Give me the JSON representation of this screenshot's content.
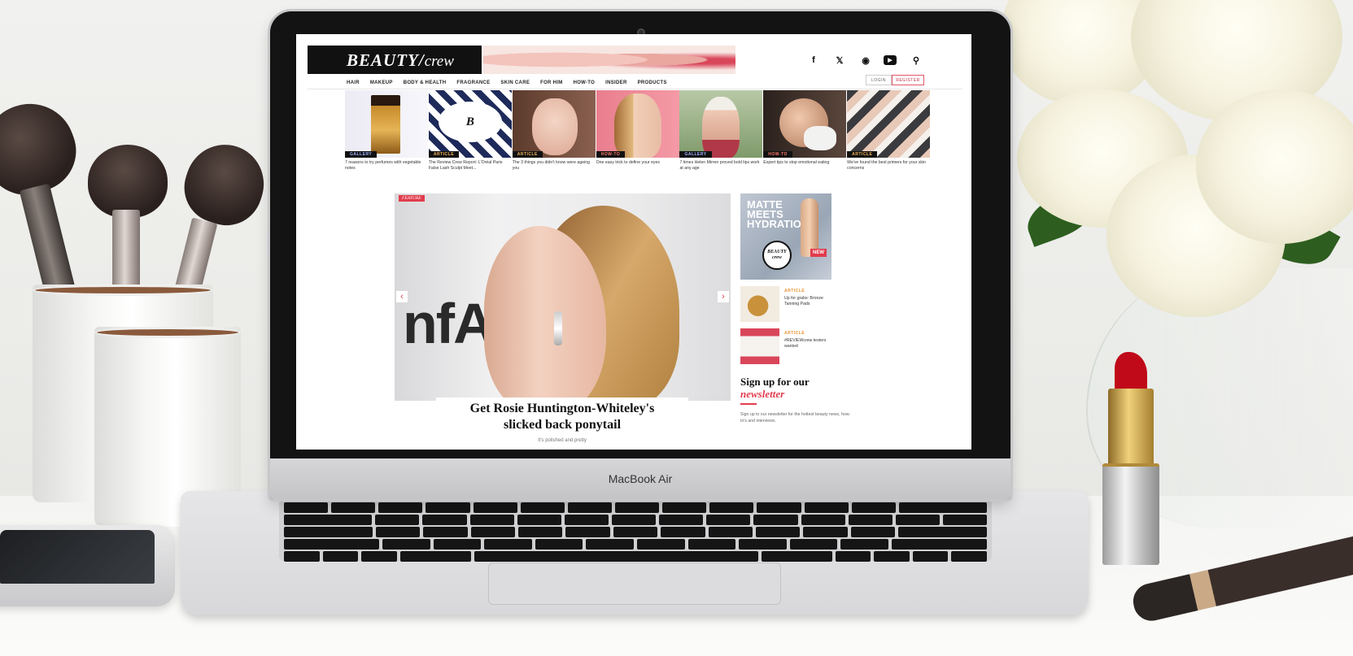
{
  "laptop": {
    "model_label": "MacBook Air"
  },
  "site": {
    "logo": "BEAUTY",
    "logo_sub": "crew",
    "social_icons": [
      "facebook-icon",
      "twitter-icon",
      "instagram-icon",
      "youtube-icon",
      "search-icon"
    ],
    "auth": {
      "login": "LOGIN",
      "register": "REGISTER"
    },
    "nav": [
      "HAIR",
      "MAKEUP",
      "BODY & HEALTH",
      "FRAGRANCE",
      "SKIN CARE",
      "FOR HIM",
      "HOW-TO",
      "INSIDER",
      "PRODUCTS"
    ],
    "cards": [
      {
        "tag": "GALLERY",
        "title": "7 reasons to try perfumes with vegetable notes"
      },
      {
        "tag": "ARTICLE",
        "title": "The Review Crew Report: L'Oréal Paris False Lash Sculpt Meet..."
      },
      {
        "tag": "ARTICLE",
        "title": "The 3 things you didn't know were ageing you"
      },
      {
        "tag": "HOW-TO",
        "title": "One easy trick to define your eyes"
      },
      {
        "tag": "GALLERY",
        "title": "7 times Helen Mirren proved bold lips work at any age"
      },
      {
        "tag": "HOW-TO",
        "title": "Expert tips to stop emotional eating"
      },
      {
        "tag": "ARTICLE",
        "title": "We've found the best primers for your skin concerns"
      }
    ],
    "hero": {
      "tag": "FEATURE",
      "backdrop_text": "nfAR",
      "headline_line1": "Get Rosie Huntington-Whiteley's",
      "headline_line2": "slicked back ponytail",
      "subtitle": "It's polished and pretty",
      "prev_arrow": "‹",
      "next_arrow": "›"
    },
    "ad": {
      "headline": "MATTE MEETS HYDRATION",
      "badge": "BEAUTY crew",
      "new_label": "NEW"
    },
    "sidebar_items": [
      {
        "tag": "ARTICLE",
        "title": "Up for grabs: Bronze Tanning Pads"
      },
      {
        "tag": "ARTICLE",
        "title": "#REVIEWcrew testers wanted"
      }
    ],
    "newsletter": {
      "title_line1": "Sign up for our",
      "title_line2": "newsletter",
      "text": "Sign up to our newsletter for the hottest beauty news, how-to's and interviews."
    }
  }
}
